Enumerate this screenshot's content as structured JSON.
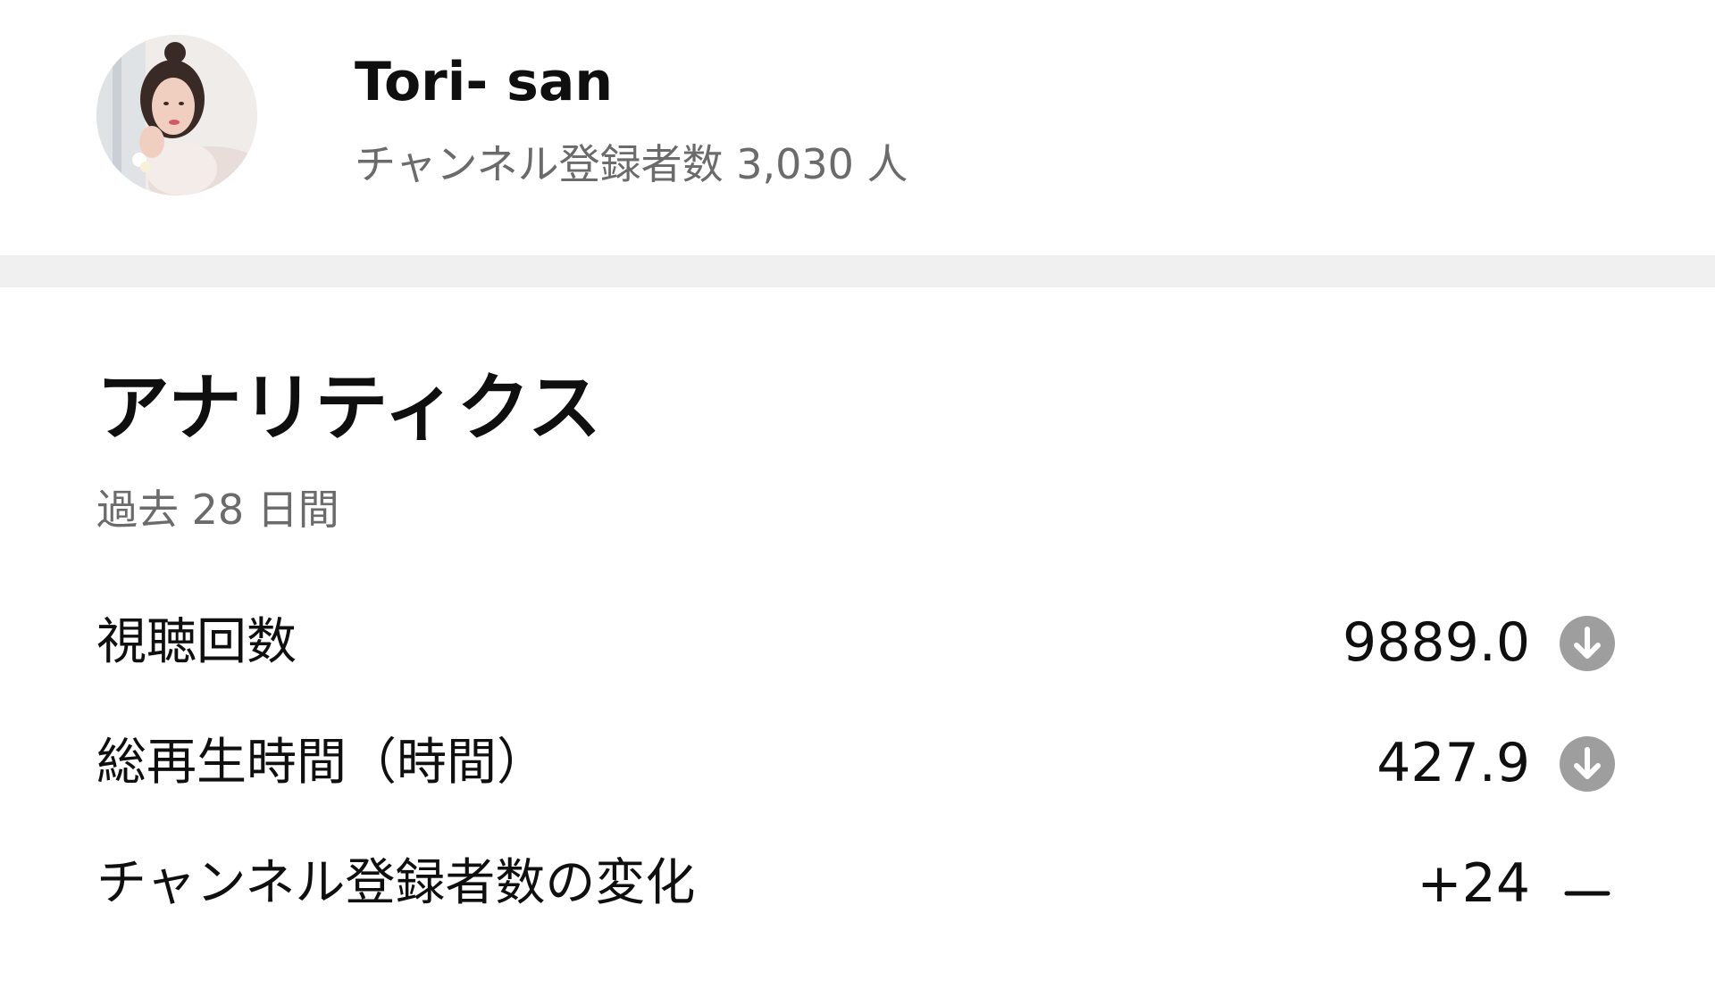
{
  "channel": {
    "name": "Tori- san",
    "subscriber_text": "チャンネル登録者数 3,030 人"
  },
  "analytics": {
    "title": "アナリティクス",
    "period": "過去 28 日間",
    "metrics": [
      {
        "label": "視聴回数",
        "value": "9889.0",
        "trend_icon": "arrow-down-circle-icon"
      },
      {
        "label": "総再生時間（時間）",
        "value": "427.9",
        "trend_icon": "arrow-down-circle-icon"
      },
      {
        "label": "チャンネル登録者数の変化",
        "value": "+24",
        "trend_icon": "dash-icon"
      }
    ]
  },
  "colors": {
    "text_primary": "#0f0f0f",
    "text_secondary": "#6b6b6b",
    "divider": "#f0f0f0",
    "trend_icon": "#9e9e9e"
  }
}
